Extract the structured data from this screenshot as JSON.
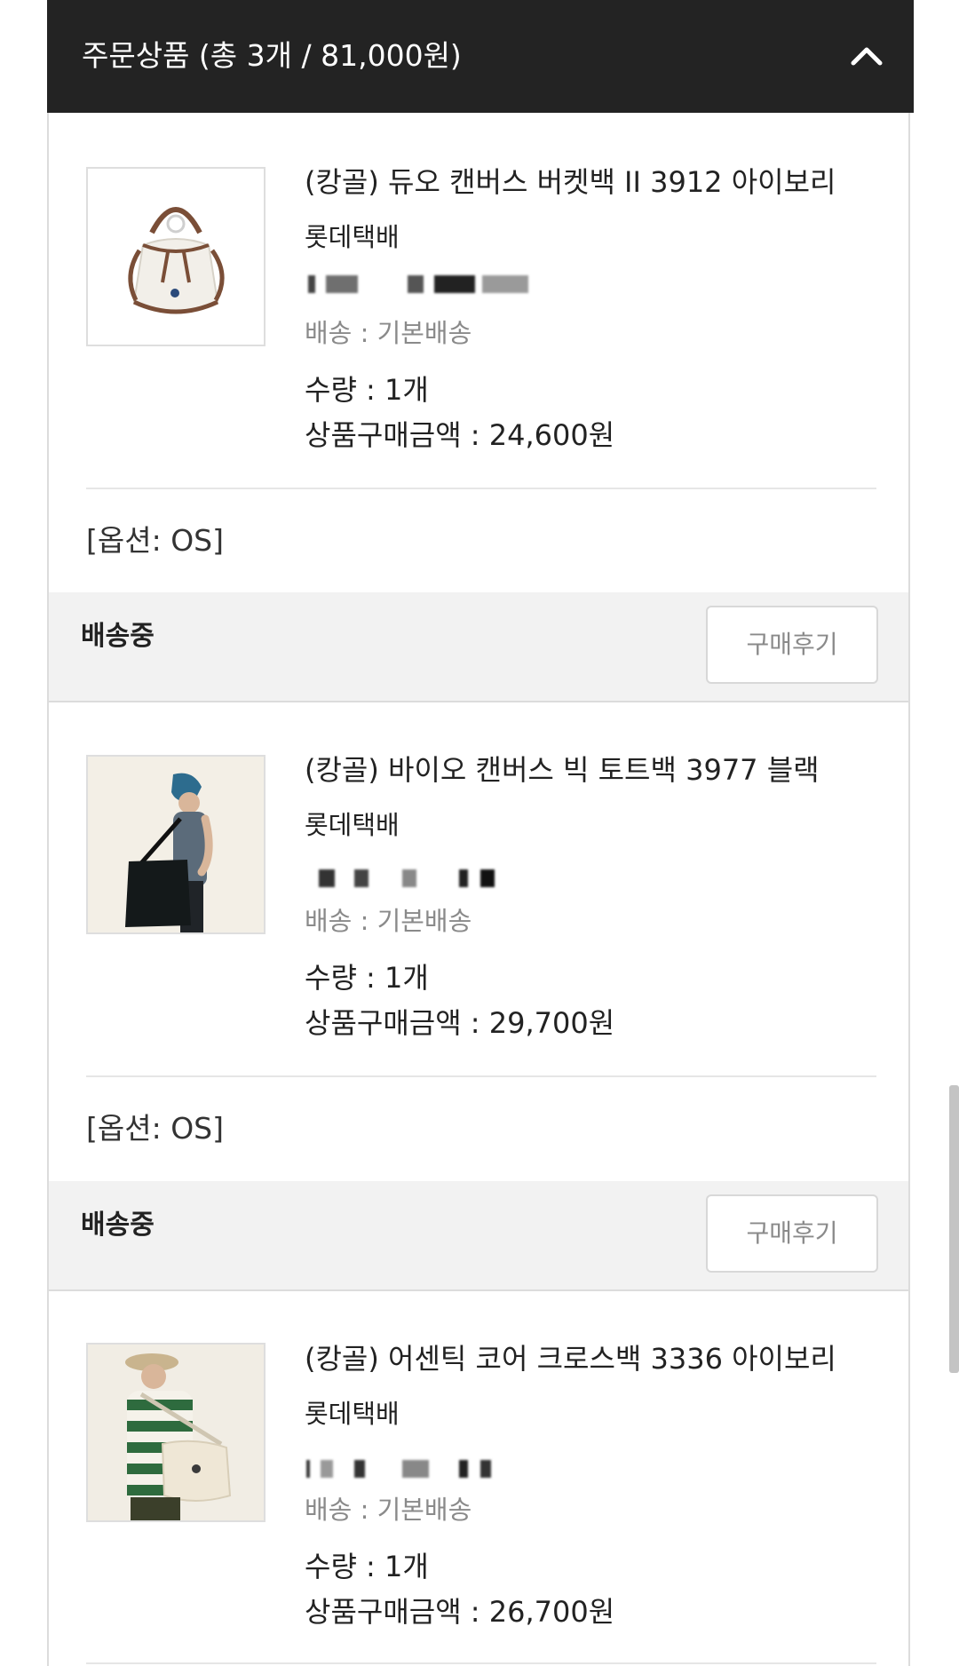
{
  "header": {
    "title": "주문상품 (총 3개 / 81,000원)",
    "collapse_icon": "chevron-up-icon"
  },
  "items": [
    {
      "name": "(캉골) 듀오 캔버스 버켓백 II 3912 아이보리",
      "carrier": "롯데택배",
      "delivery": "배송 : 기본배송",
      "quantity": "수량 : 1개",
      "price": "상품구매금액 : 24,600원",
      "option": "[옵션: OS]",
      "status": "배송중",
      "review_label": "구매후기"
    },
    {
      "name": "(캉골) 바이오 캔버스 빅 토트백 3977 블랙",
      "carrier": "롯데택배",
      "delivery": "배송 : 기본배송",
      "quantity": "수량 : 1개",
      "price": "상품구매금액 : 29,700원",
      "option": "[옵션: OS]",
      "status": "배송중",
      "review_label": "구매후기"
    },
    {
      "name": "(캉골) 어센틱 코어 크로스백 3336 아이보리",
      "carrier": "롯데택배",
      "delivery": "배송 : 기본배송",
      "quantity": "수량 : 1개",
      "price": "상품구매금액 : 26,700원"
    }
  ]
}
